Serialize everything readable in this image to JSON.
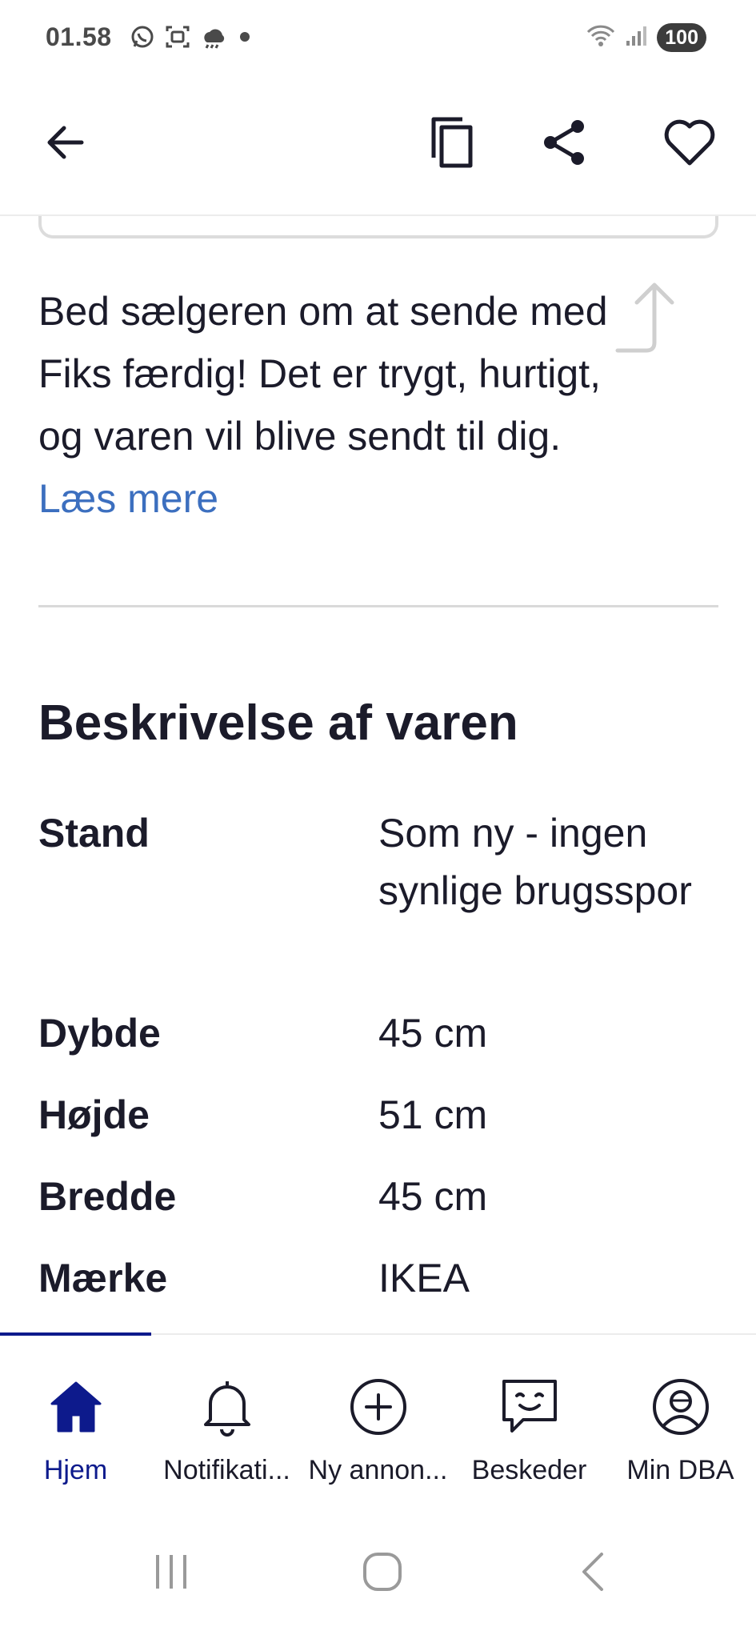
{
  "status_bar": {
    "time": "01.58",
    "battery": "100",
    "left_icons": [
      "whatsapp-icon",
      "screenshot-icon",
      "weather-icon",
      "dot-icon"
    ],
    "right_icons": [
      "wifi-icon",
      "signal-icon"
    ]
  },
  "app_bar": {
    "icons": [
      "back-arrow-icon",
      "copy-icon",
      "share-icon",
      "heart-icon"
    ]
  },
  "fiks": {
    "text": "Bed sælgeren om at sende med Fiks færdig! Det er trygt, hurtigt, og varen vil blive sendt til dig. ",
    "link": "Læs mere"
  },
  "description": {
    "title": "Beskrivelse af varen",
    "rows": [
      {
        "label": "Stand",
        "value": "Som ny - ingen synlige brugsspor"
      },
      {
        "label": "Dybde",
        "value": "45 cm"
      },
      {
        "label": "Højde",
        "value": "51 cm"
      },
      {
        "label": "Bredde",
        "value": "45 cm"
      },
      {
        "label": "Mærke",
        "value": "IKEA"
      }
    ]
  },
  "bottom_nav": {
    "items": [
      {
        "label": "Hjem",
        "icon": "home-icon",
        "active": true
      },
      {
        "label": "Notifikati...",
        "icon": "bell-icon",
        "active": false
      },
      {
        "label": "Ny annon...",
        "icon": "plus-circle-icon",
        "active": false
      },
      {
        "label": "Beskeder",
        "icon": "chat-icon",
        "active": false
      },
      {
        "label": "Min DBA",
        "icon": "profile-icon",
        "active": false
      }
    ]
  },
  "colors": {
    "accent": "#0d1a8c",
    "link": "#3c6fbf",
    "text": "#1b1b2a"
  }
}
